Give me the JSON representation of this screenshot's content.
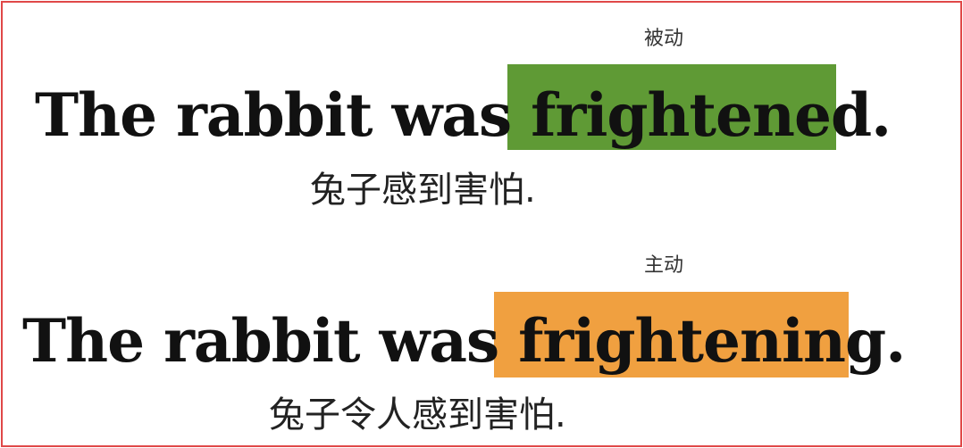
{
  "slides": {
    "passive": {
      "tag": "被动",
      "lead": "The rabbit was ",
      "verb": "frightened",
      "end": ".",
      "translation": "兔子感到害怕.",
      "highlight_color": "#5f9a35"
    },
    "active": {
      "tag": "主动",
      "lead": "The rabbit was ",
      "verb": "frightening",
      "end": ".",
      "translation": "兔子令人感到害怕.",
      "highlight_color": "#f0a040"
    }
  }
}
